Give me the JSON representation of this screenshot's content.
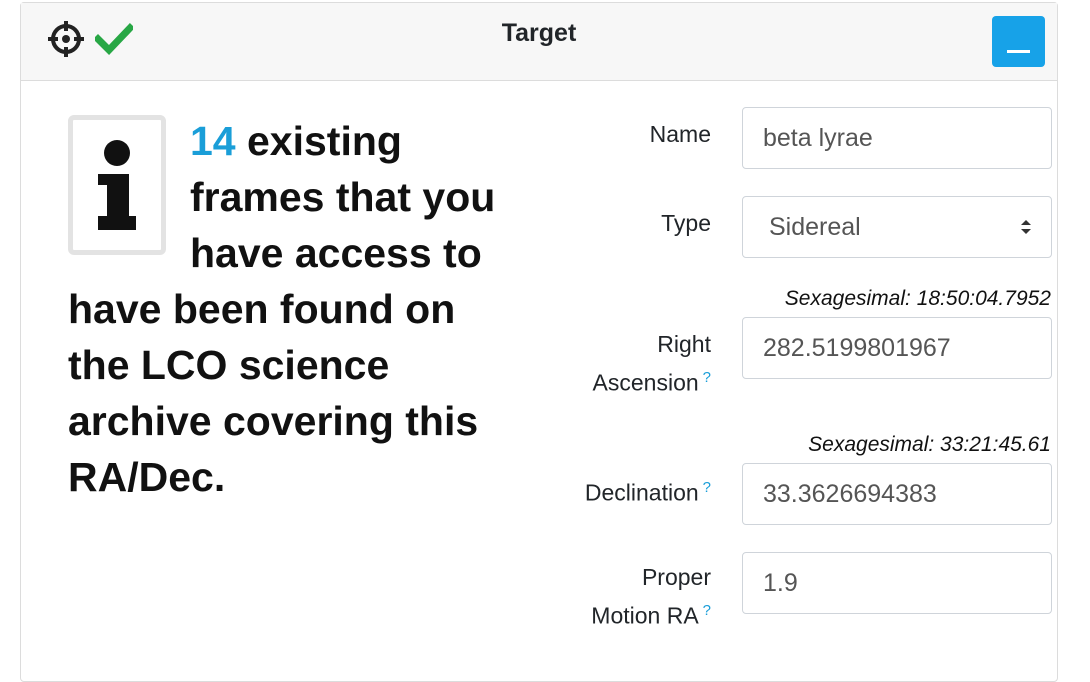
{
  "header": {
    "title": "Target",
    "icons": [
      "crosshair-icon",
      "check-icon"
    ],
    "minimize_icon": "minus-icon"
  },
  "info": {
    "icon": "info-icon",
    "count": "14",
    "message": " existing frames that you have access to have been found on the LCO science archive covering this RA/Dec."
  },
  "form": {
    "name": {
      "label": "Name",
      "value": "beta lyrae"
    },
    "type": {
      "label": "Type",
      "value": "Sidereal"
    },
    "ra": {
      "label": "Right Ascension",
      "help": "?",
      "value": "282.5199801967",
      "sexagesimal": "Sexagesimal: 18:50:04.7952"
    },
    "dec": {
      "label": "Declination",
      "help": "?",
      "value": "33.3626694383",
      "sexagesimal": "Sexagesimal: 33:21:45.61"
    },
    "pm_ra": {
      "label": "Proper Motion RA",
      "help": "?",
      "value": "1.9"
    }
  },
  "colors": {
    "accent": "#17a2e8",
    "check": "#28a745",
    "count": "#1a9ed8"
  }
}
